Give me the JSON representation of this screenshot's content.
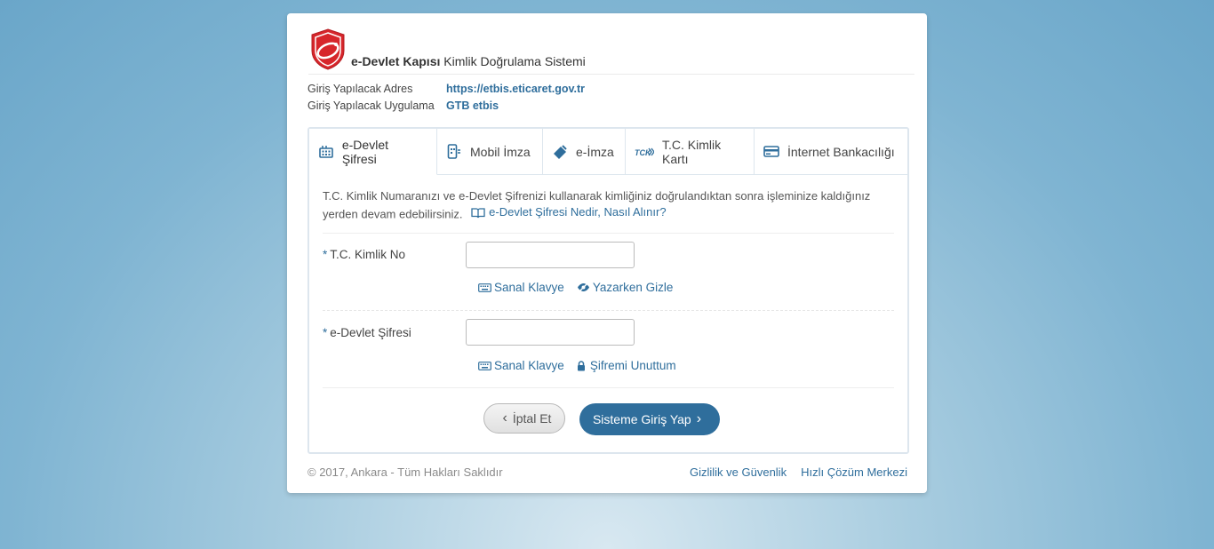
{
  "header": {
    "brand_bold": "e-Devlet Kapısı",
    "brand_rest": " Kimlik Doğrulama Sistemi"
  },
  "meta": {
    "address_key": "Giriş Yapılacak Adres",
    "address_val": "https://etbis.eticaret.gov.tr",
    "app_key": "Giriş Yapılacak Uygulama",
    "app_val": "GTB etbis"
  },
  "tabs": [
    {
      "label": "e-Devlet Şifresi",
      "icon": "keypad-icon"
    },
    {
      "label": "Mobil İmza",
      "icon": "mobile-signature-icon"
    },
    {
      "label": "e-İmza",
      "icon": "usb-token-icon"
    },
    {
      "label": "T.C. Kimlik Kartı",
      "icon": "id-card-icon"
    },
    {
      "label": "İnternet Bankacılığı",
      "icon": "credit-card-icon"
    }
  ],
  "description": {
    "text": "T.C. Kimlik Numaranızı ve e-Devlet Şifrenizi kullanarak kimliğiniz doğrulandıktan sonra işleminize kaldığınız yerden devam edebilirsiniz.",
    "help_link": "e-Devlet Şifresi Nedir, Nasıl Alınır?"
  },
  "form": {
    "tc_label": "T.C. Kimlik No",
    "tc_value": "",
    "password_label": "e-Devlet Şifresi",
    "password_value": "",
    "required_mark": "*",
    "virtual_keyboard": "Sanal Klavye",
    "hide_typing": "Yazarken Gizle",
    "forgot_password": "Şifremi Unuttum"
  },
  "buttons": {
    "cancel": "İptal Et",
    "submit": "Sisteme Giriş Yap"
  },
  "footer": {
    "copyright": "© 2017, Ankara - Tüm Hakları Saklıdır",
    "privacy": "Gizlilik ve Güvenlik",
    "support": "Hızlı Çözüm Merkezi"
  },
  "colors": {
    "accent": "#2f6e9c",
    "logo_red": "#d7262b"
  }
}
